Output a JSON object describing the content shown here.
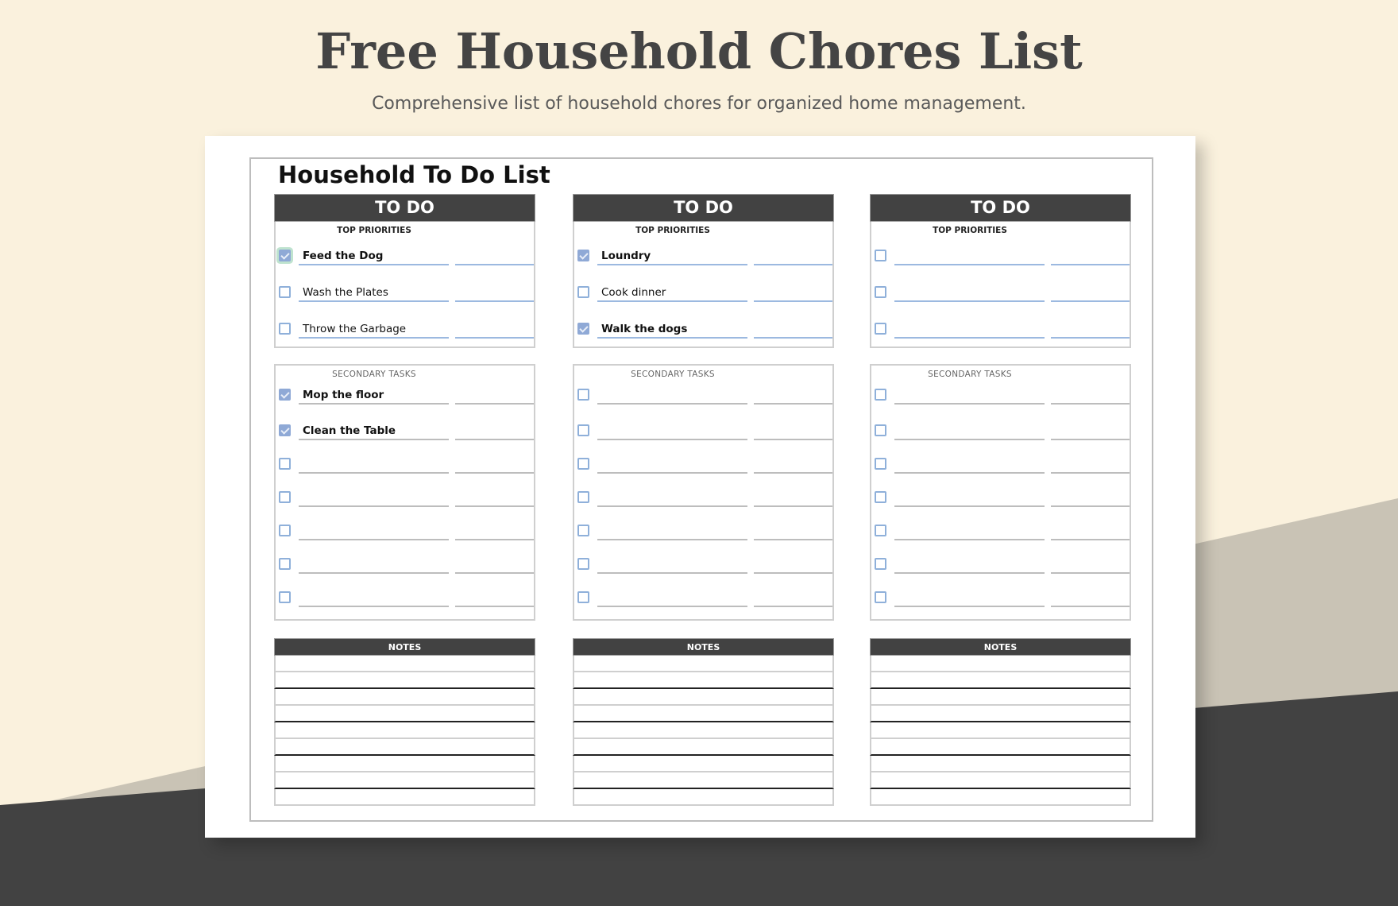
{
  "header": {
    "title": "Free Household Chores List",
    "subtitle": "Comprehensive list of household chores for organized home management."
  },
  "colors": {
    "background_cream": "#faf1dd",
    "background_taupe": "#c9c3b5",
    "background_dark": "#424242",
    "header_bar": "#424242",
    "checkbox_blue": "#8fa9d6"
  },
  "sheet": {
    "title": "Household To Do List",
    "columns": [
      {
        "header": "TO DO",
        "top_label": "TOP PRIORITIES",
        "top_tasks": [
          {
            "text": "Feed the Dog",
            "checked": true
          },
          {
            "text": "Wash the Plates",
            "checked": false
          },
          {
            "text": "Throw the Garbage",
            "checked": false
          }
        ],
        "secondary_label": "SECONDARY TASKS",
        "secondary_tasks": [
          {
            "text": "Mop the floor",
            "checked": true
          },
          {
            "text": "Clean the Table",
            "checked": true
          },
          {
            "text": "",
            "checked": false
          },
          {
            "text": "",
            "checked": false
          },
          {
            "text": "",
            "checked": false
          },
          {
            "text": "",
            "checked": false
          },
          {
            "text": "",
            "checked": false
          }
        ],
        "notes_label": "NOTES"
      },
      {
        "header": "TO DO",
        "top_label": "TOP PRIORITIES",
        "top_tasks": [
          {
            "text": "Loundry",
            "checked": true
          },
          {
            "text": "Cook dinner",
            "checked": false
          },
          {
            "text": "Walk the dogs",
            "checked": true
          }
        ],
        "secondary_label": "SECONDARY TASKS",
        "secondary_tasks": [
          {
            "text": "",
            "checked": false
          },
          {
            "text": "",
            "checked": false
          },
          {
            "text": "",
            "checked": false
          },
          {
            "text": "",
            "checked": false
          },
          {
            "text": "",
            "checked": false
          },
          {
            "text": "",
            "checked": false
          },
          {
            "text": "",
            "checked": false
          }
        ],
        "notes_label": "NOTES"
      },
      {
        "header": "TO DO",
        "top_label": "TOP PRIORITIES",
        "top_tasks": [
          {
            "text": "",
            "checked": false
          },
          {
            "text": "",
            "checked": false
          },
          {
            "text": "",
            "checked": false
          }
        ],
        "secondary_label": "SECONDARY TASKS",
        "secondary_tasks": [
          {
            "text": "",
            "checked": false
          },
          {
            "text": "",
            "checked": false
          },
          {
            "text": "",
            "checked": false
          },
          {
            "text": "",
            "checked": false
          },
          {
            "text": "",
            "checked": false
          },
          {
            "text": "",
            "checked": false
          },
          {
            "text": "",
            "checked": false
          }
        ],
        "notes_label": "NOTES"
      }
    ]
  }
}
